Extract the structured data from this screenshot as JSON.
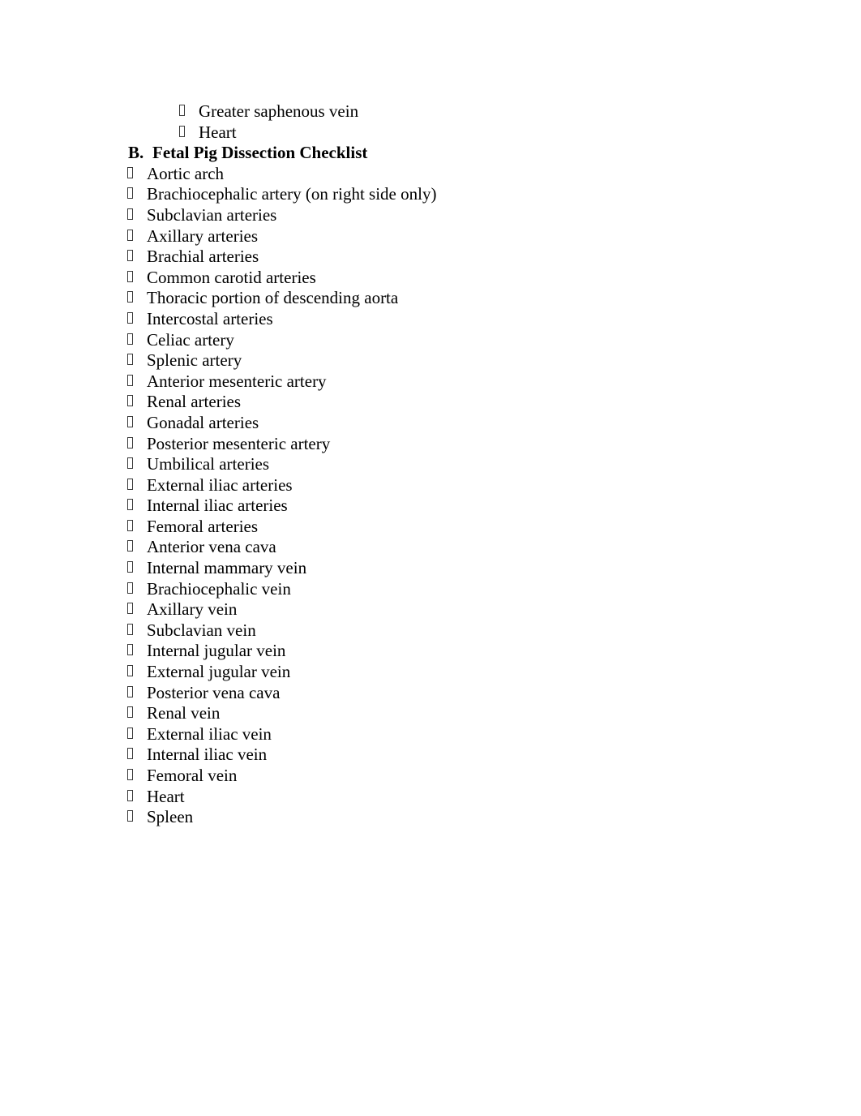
{
  "document": {
    "marker_glyph": "missing-glyph-box",
    "text_color": "#000000",
    "background_color": "#ffffff"
  },
  "sub_items_before_heading": [
    {
      "label": "Greater saphenous vein"
    },
    {
      "label": "Heart"
    }
  ],
  "heading": {
    "letter": "B.",
    "title": "Fetal Pig Dissection Checklist"
  },
  "checklist_items": [
    {
      "label": "Aortic arch"
    },
    {
      "label": "Brachiocephalic artery (on right side only)"
    },
    {
      "label": "Subclavian arteries"
    },
    {
      "label": "Axillary arteries"
    },
    {
      "label": "Brachial arteries"
    },
    {
      "label": "Common carotid arteries"
    },
    {
      "label": "Thoracic portion of descending aorta"
    },
    {
      "label": "Intercostal arteries"
    },
    {
      "label": "Celiac artery"
    },
    {
      "label": "Splenic artery"
    },
    {
      "label": "Anterior mesenteric artery"
    },
    {
      "label": "Renal arteries"
    },
    {
      "label": "Gonadal arteries"
    },
    {
      "label": "Posterior mesenteric artery"
    },
    {
      "label": "Umbilical arteries"
    },
    {
      "label": "External iliac arteries"
    },
    {
      "label": "Internal iliac arteries"
    },
    {
      "label": "Femoral arteries"
    },
    {
      "label": "Anterior vena cava"
    },
    {
      "label": "Internal mammary vein"
    },
    {
      "label": "Brachiocephalic vein"
    },
    {
      "label": "Axillary vein"
    },
    {
      "label": "Subclavian vein"
    },
    {
      "label": "Internal jugular vein"
    },
    {
      "label": "External jugular vein"
    },
    {
      "label": "Posterior vena cava"
    },
    {
      "label": "Renal vein"
    },
    {
      "label": "External iliac vein"
    },
    {
      "label": "Internal iliac vein"
    },
    {
      "label": "Femoral vein"
    },
    {
      "label": "Heart"
    },
    {
      "label": "Spleen"
    }
  ]
}
